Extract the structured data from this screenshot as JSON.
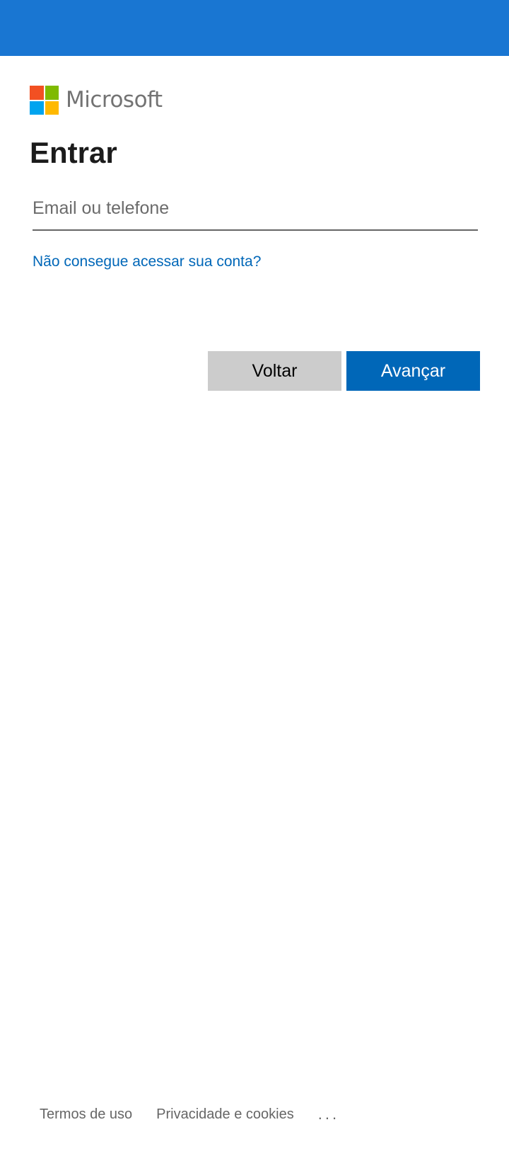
{
  "header": {
    "bar_color": "#1976d2"
  },
  "logo": {
    "wordmark": "Microsoft",
    "colors": [
      "#f25022",
      "#7fba00",
      "#00a4ef",
      "#ffb900"
    ]
  },
  "signin": {
    "title": "Entrar",
    "identifier_placeholder": "Email ou telefone",
    "identifier_value": "",
    "cant_access_link": "Não consegue acessar sua conta?",
    "back_label": "Voltar",
    "next_label": "Avançar",
    "accent_color": "#0067b8"
  },
  "footer": {
    "terms": "Termos de uso",
    "privacy": "Privacidade e cookies",
    "more": "..."
  }
}
